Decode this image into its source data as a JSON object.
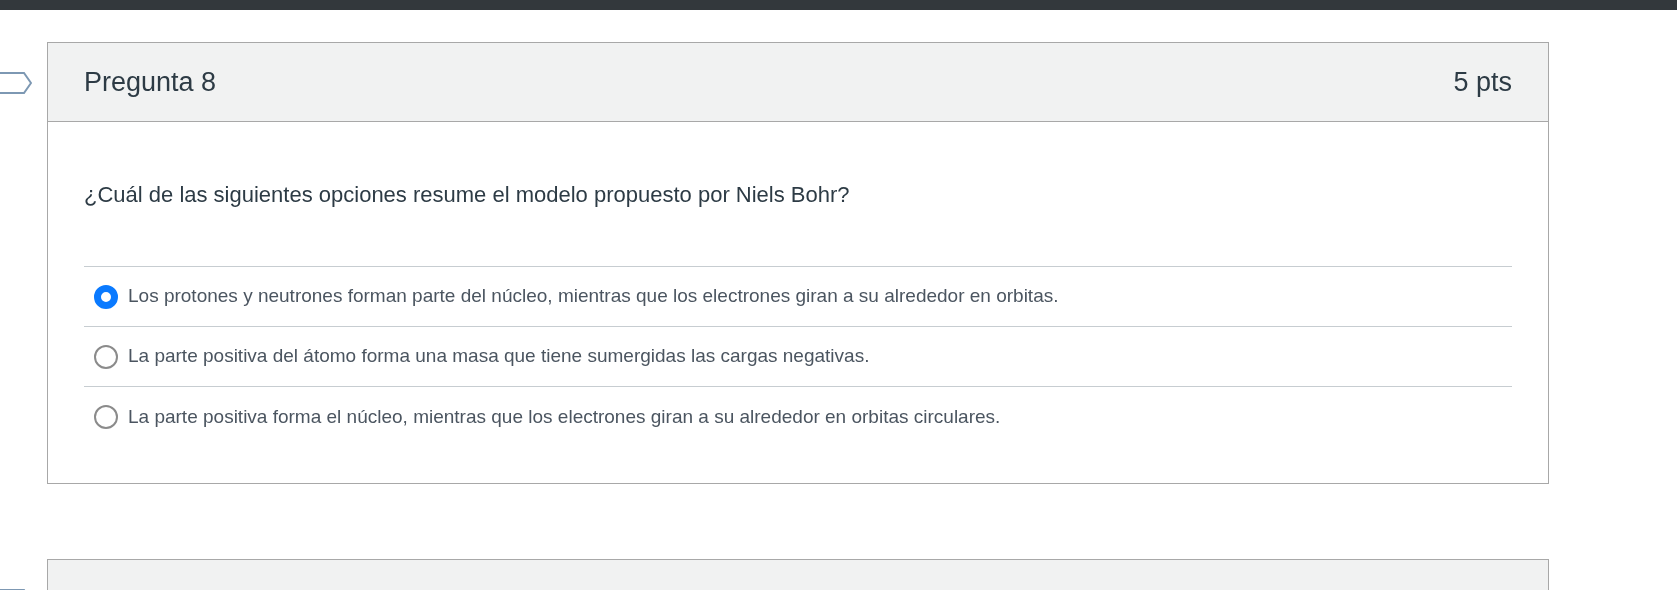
{
  "questions": [
    {
      "title": "Pregunta 8",
      "points": "5 pts",
      "text": "¿Cuál de las siguientes opciones resume el modelo propuesto por Niels Bohr?",
      "answers": [
        {
          "label": "Los protones y neutrones forman parte del núcleo, mientras que los electrones giran a su alrededor en orbitas.",
          "selected": true
        },
        {
          "label": "La parte positiva del átomo forma una masa que tiene sumergidas las cargas negativas.",
          "selected": false
        },
        {
          "label": "La parte positiva forma el núcleo, mientras que los electrones giran a su alrededor en orbitas circulares.",
          "selected": false
        }
      ]
    }
  ]
}
